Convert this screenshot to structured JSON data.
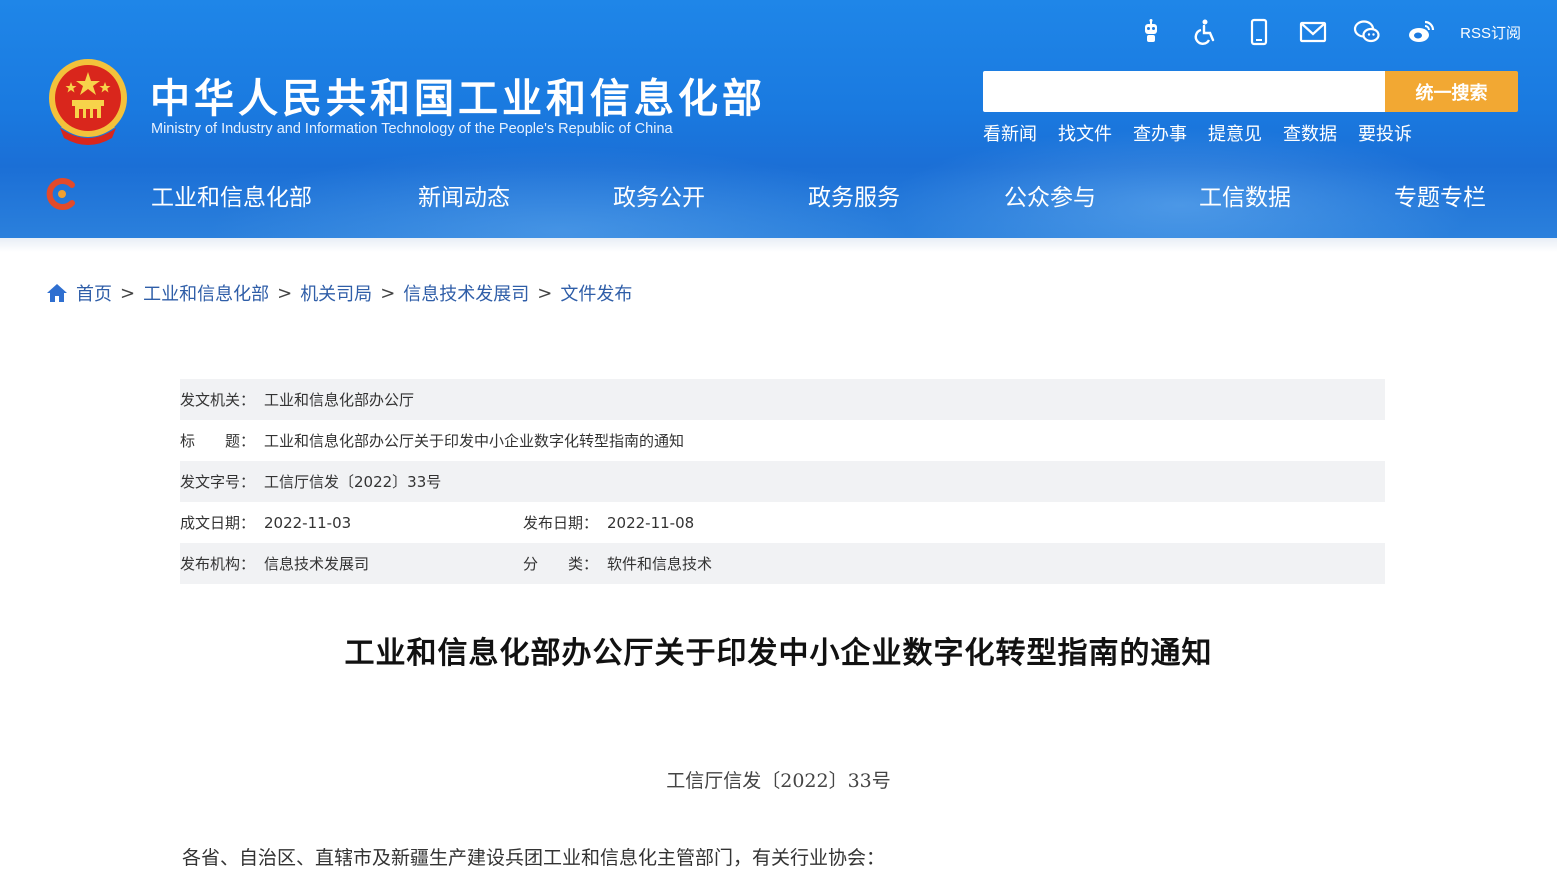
{
  "header": {
    "site_title": "中华人民共和国工业和信息化部",
    "site_subtitle": "Ministry of Industry and Information Technology of the People's Republic of China",
    "toolbar": {
      "icons": [
        "robot-icon",
        "accessibility-icon",
        "mobile-icon",
        "mail-icon",
        "wechat-icon",
        "weibo-icon"
      ],
      "rss_label": "RSS订阅"
    },
    "search": {
      "placeholder": "",
      "button_label": "统一搜索"
    },
    "quick_links": [
      "看新闻",
      "找文件",
      "查办事",
      "提意见",
      "查数据",
      "要投诉"
    ],
    "nav": [
      "工业和信息化部",
      "新闻动态",
      "政务公开",
      "政务服务",
      "公众参与",
      "工信数据",
      "专题专栏"
    ]
  },
  "breadcrumb": [
    "首页",
    "工业和信息化部",
    "机关司局",
    "信息技术发展司",
    "文件发布"
  ],
  "info": {
    "issuer_label": "发文机关：",
    "issuer": "工业和信息化部办公厅",
    "title_label": "标　　题：",
    "title": "工业和信息化部办公厅关于印发中小企业数字化转型指南的通知",
    "doc_no_label": "发文字号：",
    "doc_no": "工信厅信发〔2022〕33号",
    "created_label": "成文日期：",
    "created": "2022-11-03",
    "published_label": "发布日期：",
    "published": "2022-11-08",
    "org_label": "发布机构：",
    "org": "信息技术发展司",
    "category_label": "分　　类：",
    "category": "软件和信息技术"
  },
  "document": {
    "title": "工业和信息化部办公厅关于印发中小企业数字化转型指南的通知",
    "number": "工信厅信发〔2022〕33号",
    "addressee": "各省、自治区、直辖市及新疆生产建设兵团工业和信息化主管部门，有关行业协会："
  },
  "colors": {
    "header_blue": "#1b7ae0",
    "search_button": "#f2a833",
    "breadcrumb_link": "#2f5ea8",
    "row_shade": "#f1f2f4"
  }
}
